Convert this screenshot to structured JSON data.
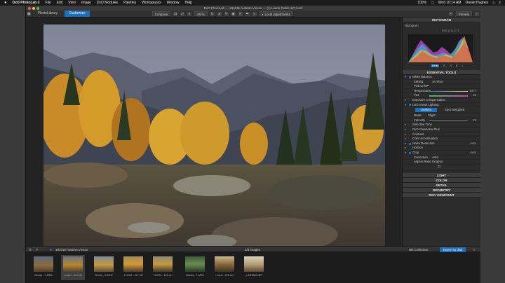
{
  "menubar": {
    "apple": "",
    "items": [
      "DxO PhotoLab 2",
      "File",
      "Edit",
      "View",
      "Image",
      "DxO Modules",
      "Palettes",
      "Workspaces",
      "Window",
      "Help"
    ],
    "battery": "100%",
    "datetime": "Wed 10:14 AM",
    "user": "Daniel Hughes"
  },
  "window": {
    "title": "DxO PhotoLab — 191016 Autumn Vivezo — (c) Laurie Rubin-1274.nef"
  },
  "tabs": {
    "library": "PhotoLibrary",
    "customize": "Customize"
  },
  "toolbar": {
    "compare": "Compare",
    "zoom": "66 %",
    "local_adjustments": "Local adjustments",
    "presets": "Presets"
  },
  "panel": {
    "histogram_title": "HISTOGRAM",
    "histogram_label": "Histogram",
    "colorspace": "RGB (3.8) 8-TE",
    "channels": [
      "RGB",
      "R",
      "G",
      "B",
      "L"
    ],
    "essential_title": "ESSENTIAL TOOLS",
    "white_balance": "White Balance",
    "wb_setting_label": "Setting",
    "wb_setting_value": "As Shot",
    "pick_color": "Pick Color",
    "temperature_label": "Temperature",
    "temperature_value": "5477",
    "tint_label": "Tint",
    "tint_value": "20",
    "exposure_comp": "Exposure Compensation",
    "smart_lighting": "DxO Smart Lighting",
    "sl_uniform": "Uniform",
    "sl_spot": "Spot Weighted",
    "sl_mode_label": "Mode",
    "sl_mode_value": "Slight",
    "sl_intensity_label": "Intensity",
    "sl_intensity_value": "25",
    "selective_tone": "Selective Tone",
    "clearview": "DxO ClearView Plus",
    "contrast": "Contrast",
    "color_accent": "Color Accentuation",
    "noise_reduction": "Noise Reduction",
    "noise_value": "Auto",
    "horizon": "Horizon",
    "crop": "Crop",
    "crop_value": "Auto",
    "correction_label": "Correction",
    "correction_value": "Auto",
    "aspect_label": "Aspect Ratio",
    "aspect_value": "Original",
    "sections": [
      "LIGHT",
      "COLOR",
      "DETAIL",
      "GEOMETRY",
      "DXO VIEWPOINT"
    ]
  },
  "filmstrip": {
    "folder": "191016 Autumn Vivezo",
    "count": "1/8 images",
    "nik": "Nik Collection",
    "export": "Export to disk",
    "items": [
      {
        "caption": "Moody - 7.ARW"
      },
      {
        "caption": "• Lauri - 373.nef"
      },
      {
        "caption": "Moody - 6.ARW"
      },
      {
        "caption": "171002 - 217.nef"
      },
      {
        "caption": "171002 - 221.nef"
      },
      {
        "caption": "Moody - 7.ARW"
      },
      {
        "caption": "• Lauri - 228.nef"
      },
      {
        "caption": "_LAR5869.NEF"
      }
    ]
  },
  "colors": {
    "accent": "#1d70b8",
    "panel": "#2c2c2c"
  }
}
